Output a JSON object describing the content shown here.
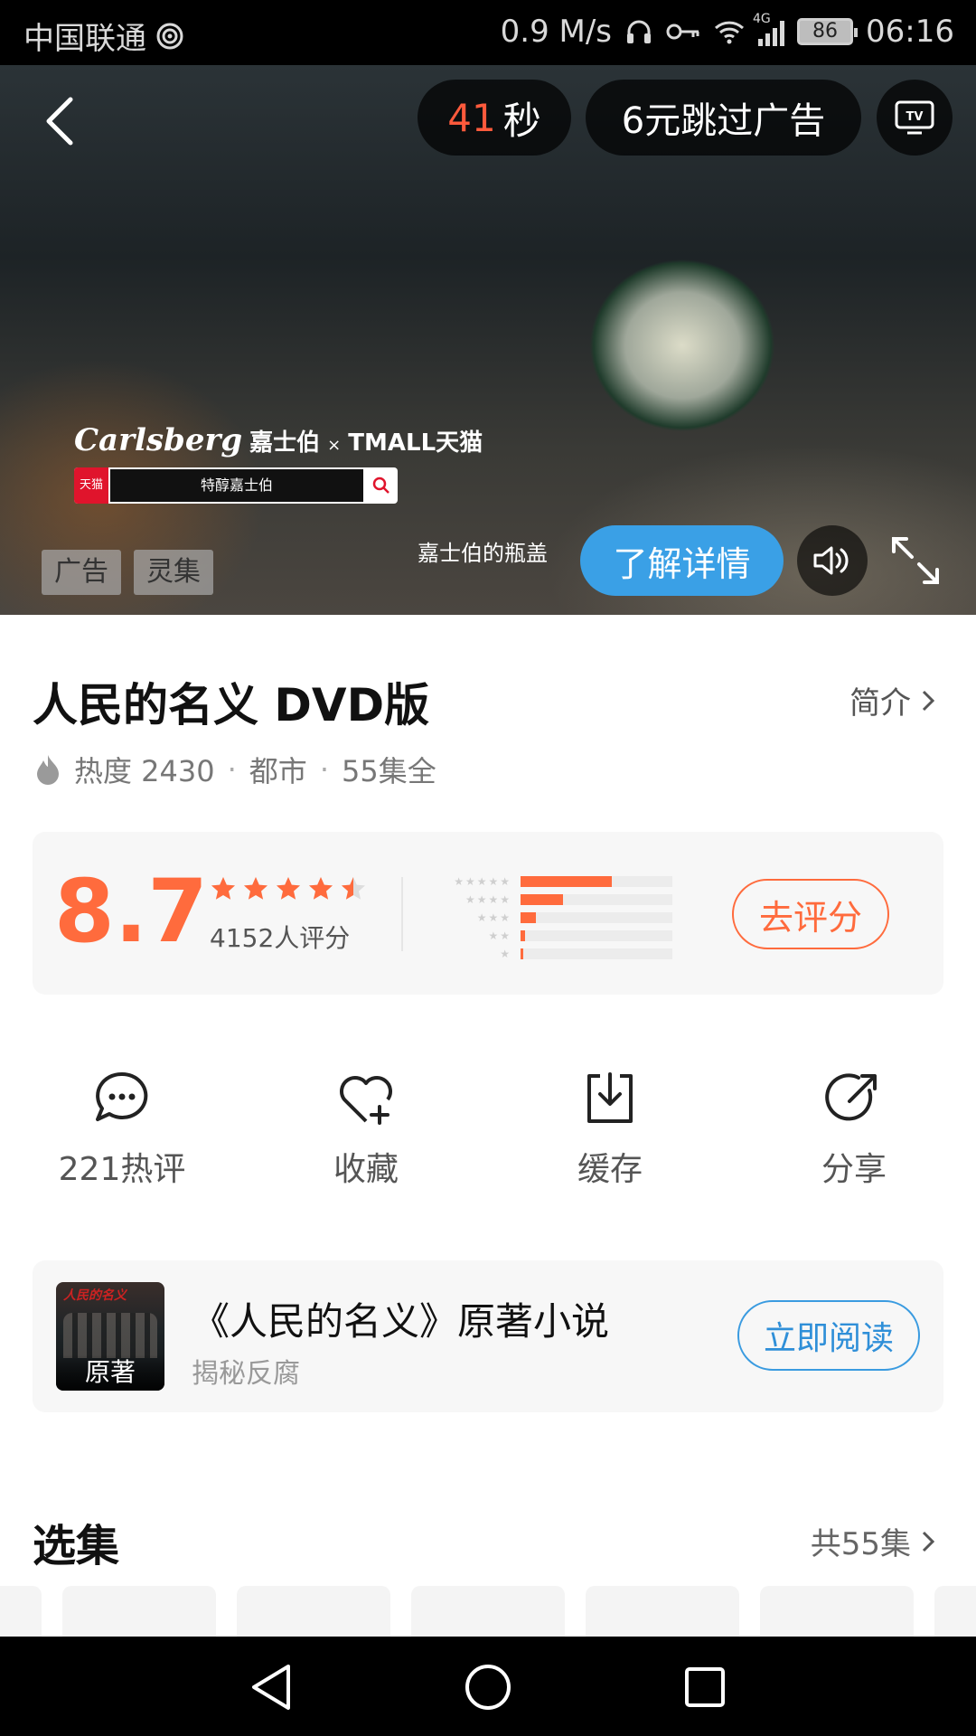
{
  "status_bar": {
    "carrier": "中国联通",
    "speed": "0.9 M/s",
    "network": "4G",
    "battery": "86",
    "time": "06:16"
  },
  "ad": {
    "countdown_number": "41",
    "countdown_unit": "秒",
    "skip_label": "6元跳过广告",
    "brand_script": "Carlsberg",
    "brand_cn": "嘉士伯",
    "brand_cross": "×",
    "partner": "TMALL天猫",
    "search_tag": "天猫",
    "search_text": "特醇嘉士伯",
    "tags": [
      "广告",
      "灵集"
    ],
    "caption": "嘉士伯的瓶盖",
    "learn_more": "了解详情"
  },
  "show": {
    "title": "人民的名义 DVD版",
    "intro_label": "简介",
    "heat": "热度 2430",
    "genre": "都市",
    "episodes": "55集全",
    "separator": "·"
  },
  "rating": {
    "score": "8.7",
    "stars": 4.5,
    "raters": "4152人评分",
    "distribution": [
      0.6,
      0.28,
      0.1,
      0.03,
      0.02
    ],
    "rate_button": "去评分",
    "accent": "#ff6b3d"
  },
  "actions": [
    {
      "icon": "comment-icon",
      "label": "221热评"
    },
    {
      "icon": "heart-plus-icon",
      "label": "收藏"
    },
    {
      "icon": "download-icon",
      "label": "缓存"
    },
    {
      "icon": "share-icon",
      "label": "分享"
    }
  ],
  "book": {
    "cover_tag": "原著",
    "cover_title": "人民的名义",
    "title": "《人民的名义》原著小说",
    "subtitle": "揭秘反腐",
    "read_button": "立即阅读"
  },
  "episodes_section": {
    "title": "选集",
    "total": "共55集"
  }
}
